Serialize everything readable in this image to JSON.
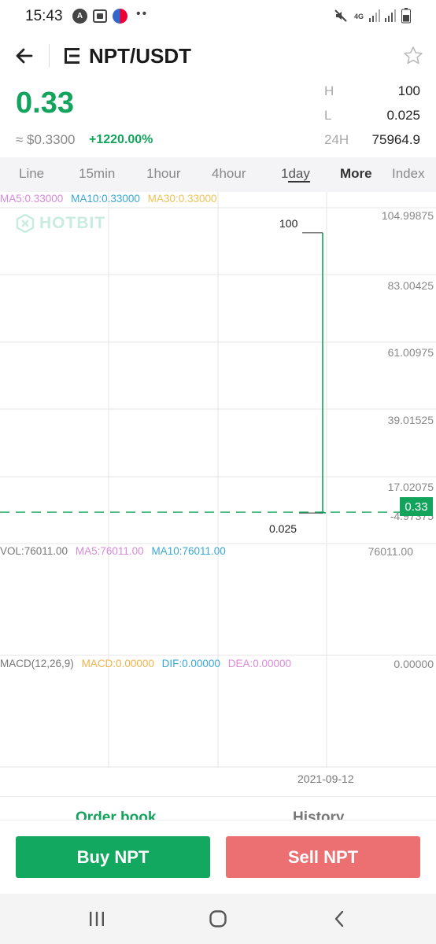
{
  "status_bar": {
    "time": "15:43",
    "left_icons": [
      "a-badge-icon",
      "screen-record-icon",
      "app-notification-icon",
      "more-dots-icon"
    ],
    "right_icons": [
      "mute-icon",
      "4g-data-icon",
      "signal-icon",
      "signal-icon-2",
      "battery-icon"
    ],
    "network_label": "4G"
  },
  "header": {
    "title": "NPT/USDT"
  },
  "price": {
    "last": "0.33",
    "approx": "≈ $0.3300",
    "change": "+1220.00%",
    "stats": [
      {
        "label": "H",
        "value": "100"
      },
      {
        "label": "L",
        "value": "0.025"
      },
      {
        "label": "24H",
        "value": "75964.9"
      }
    ]
  },
  "intervals": {
    "items": [
      "Line",
      "15min",
      "1hour",
      "4hour",
      "1day",
      "More",
      "Index"
    ],
    "active_prefix": "1",
    "active_underlined": "day"
  },
  "chart": {
    "ma": {
      "ma5": "MA5:0.33000",
      "ma10": "MA10:0.33000",
      "ma30": "MA30:0.33000"
    },
    "watermark": "HOTBIT",
    "y_axis": [
      "104.99875",
      "83.00425",
      "61.00975",
      "39.01525",
      "17.02075",
      "-4.97375"
    ],
    "high_mark": "100",
    "low_mark": "0.025",
    "current_price": "0.33",
    "vol": {
      "vol": "VOL:76011.00",
      "ma5": "MA5:76011.00",
      "ma10": "MA10:76011.00",
      "axis": "76011.00"
    },
    "macd": {
      "label": "MACD(12,26,9)",
      "macd": "MACD:0.00000",
      "dif": "DIF:0.00000",
      "dea": "DEA:0.00000",
      "axis": "0.00000"
    },
    "date": "2021-09-12",
    "colors": {
      "up": "#12a35c",
      "grid": "#e6e6e6"
    }
  },
  "chart_data": {
    "type": "candlestick",
    "x": [
      "2021-09-12"
    ],
    "open": [
      0.025
    ],
    "high": [
      100
    ],
    "low": [
      0.025
    ],
    "close": [
      0.33
    ],
    "volume": [
      76011.0
    ],
    "ylim": [
      -4.97375,
      104.99875
    ]
  },
  "tabs": {
    "order_book": "Order book",
    "history": "History"
  },
  "actions": {
    "buy": "Buy NPT",
    "sell": "Sell NPT",
    "buy_color": "#13a85f",
    "sell_color": "#ec7071"
  }
}
